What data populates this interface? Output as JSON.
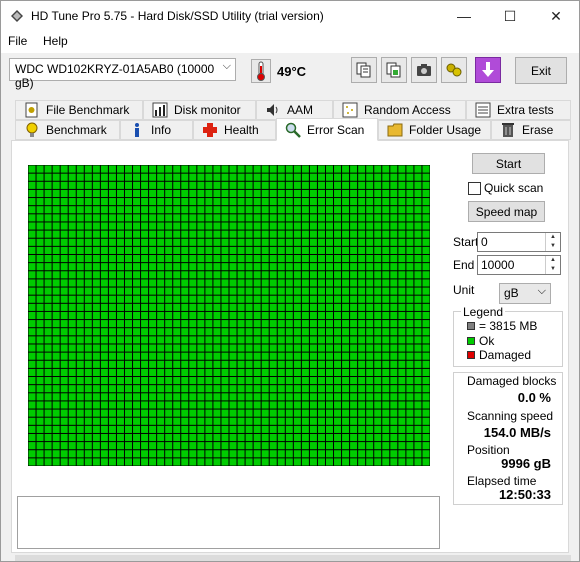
{
  "window": {
    "title": "HD Tune Pro 5.75 - Hard Disk/SSD Utility (trial version)",
    "min_glyph": "—",
    "max_glyph": "☐",
    "close_glyph": "✕"
  },
  "menu": {
    "file": "File",
    "help": "Help"
  },
  "toolbar": {
    "drive": "WDC WD102KRYZ-01A5AB0 (10000 gB)",
    "temperature": "49°C",
    "exit_label": "Exit",
    "icons": [
      "copy-text-icon",
      "copy-image-icon",
      "camera-icon",
      "options-icon",
      "save-icon"
    ]
  },
  "tabs_top": [
    {
      "label": "File Benchmark",
      "icon": "file-benchmark-icon"
    },
    {
      "label": "Disk monitor",
      "icon": "disk-monitor-icon"
    },
    {
      "label": "AAM",
      "icon": "aam-icon"
    },
    {
      "label": "Random Access",
      "icon": "random-access-icon"
    },
    {
      "label": "Extra tests",
      "icon": "extra-tests-icon"
    }
  ],
  "tabs_bottom": [
    {
      "label": "Benchmark",
      "icon": "benchmark-icon"
    },
    {
      "label": "Info",
      "icon": "info-icon"
    },
    {
      "label": "Health",
      "icon": "health-icon"
    },
    {
      "label": "Error Scan",
      "icon": "error-scan-icon",
      "active": true
    },
    {
      "label": "Folder Usage",
      "icon": "folder-icon"
    },
    {
      "label": "Erase",
      "icon": "erase-icon"
    }
  ],
  "scan": {
    "grid_columns": 50,
    "grid_rows": 37,
    "ok_color": "#00cc00",
    "damaged_color": "#e00000",
    "unit_block_color": "#808080"
  },
  "controls": {
    "start_button": "Start",
    "quick_scan_label": "Quick scan",
    "quick_scan_checked": false,
    "speed_map_button": "Speed map",
    "start_label": "Start",
    "start_value": "0",
    "end_label": "End",
    "end_value": "10000",
    "unit_label": "Unit",
    "unit_value": "gB"
  },
  "legend": {
    "title": "Legend",
    "block_size": "= 3815 MB",
    "ok": "Ok",
    "damaged": "Damaged"
  },
  "stats": {
    "damaged_blocks_label": "Damaged blocks",
    "damaged_blocks_value": "0.0 %",
    "scanning_speed_label": "Scanning speed",
    "scanning_speed_value": "154.0 MB/s",
    "position_label": "Position",
    "position_value": "9996 gB",
    "elapsed_label": "Elapsed time",
    "elapsed_value": "12:50:33"
  }
}
